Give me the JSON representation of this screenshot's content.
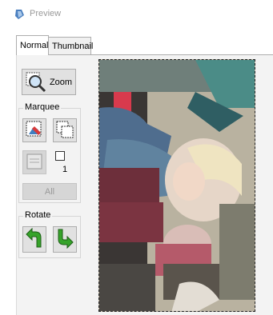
{
  "window": {
    "title": "Preview",
    "icon": "preview-app-icon"
  },
  "tabs": [
    {
      "label": "Normal",
      "active": true
    },
    {
      "label": "Thumbnail",
      "active": false
    }
  ],
  "zoom": {
    "label": "Zoom",
    "icon": "zoom-magnifier-icon"
  },
  "marquee": {
    "group_label": "Marquee",
    "create_icon": "create-marquee-icon",
    "duplicate_icon": "duplicate-marquee-icon",
    "auto_locate_icon": "auto-locate-icon",
    "count": "1",
    "all_label": "All"
  },
  "rotate": {
    "group_label": "Rotate",
    "left_icon": "rotate-left-arrow-icon",
    "right_icon": "rotate-right-arrow-icon"
  },
  "colors": {
    "accent": "#2e8b1f",
    "panel": "#f3f3f3",
    "button": "#e1e1e1"
  }
}
